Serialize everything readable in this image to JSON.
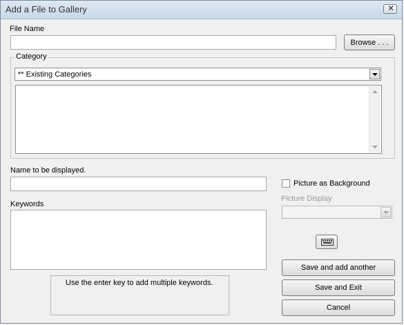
{
  "window": {
    "title": "Add a File to Gallery",
    "close_glyph": "✕"
  },
  "file_name": {
    "label": "File Name",
    "value": "",
    "browse_label": "Browse . . ."
  },
  "category": {
    "legend": "Category",
    "selected": "** Existing Categories",
    "list_items": []
  },
  "display_name": {
    "label": "Name to be displayed.",
    "value": ""
  },
  "picture_background": {
    "label": "Picture as Background",
    "checked": false
  },
  "picture_display": {
    "label": "Picture Display",
    "value": "",
    "enabled": false
  },
  "keywords": {
    "label": "Keywords",
    "value": "",
    "hint": "Use the enter key to add multiple keywords."
  },
  "icons": {
    "keyboard": "keyboard-icon"
  },
  "buttons": {
    "save_add_another": "Save and add another",
    "save_exit": "Save and Exit",
    "cancel": "Cancel"
  }
}
